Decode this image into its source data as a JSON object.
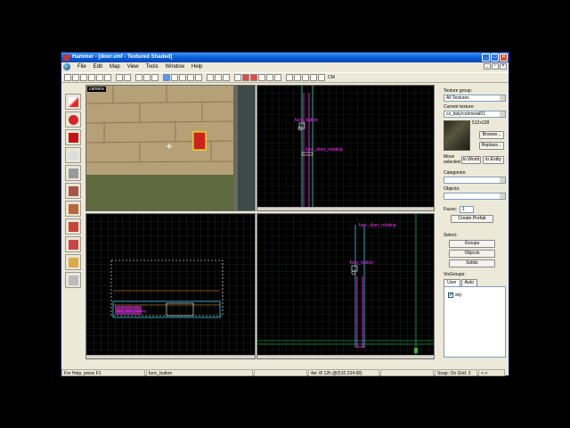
{
  "window": {
    "title": "Hammer - [door.vmf - Textured Shaded]"
  },
  "menu": [
    "File",
    "Edit",
    "Map",
    "View",
    "Tools",
    "Window",
    "Help"
  ],
  "toolbar": {
    "cm_label": "CM"
  },
  "viewports": {
    "camera_label": "camera",
    "top_labels": [
      "func_button",
      "func_door_rotating"
    ],
    "side_labels": [
      "func_door_rotating",
      "func_button",
      "door"
    ],
    "front_labels": [
      "func_door_rotating"
    ]
  },
  "texture_panel": {
    "group_label": "Texture group:",
    "group_value": "All Textures",
    "current_label": "Current texture:",
    "current_value": "cs_italy/cobmetal01",
    "size": "512x128",
    "browse": "Browse...",
    "replace": "Replace...",
    "move_label": "Move selected",
    "to_world": "to World",
    "to_entity": "to Entity",
    "categories_label": "Categories:",
    "objects_label": "Objects:",
    "faces_label": "Faces:",
    "faces_value": "1",
    "create_prefab": "Create Prefab",
    "select_label": "Select:",
    "groups": "Groups",
    "objects_btn": "Objects",
    "solids": "Solids",
    "visgroups_label": "VisGroups:",
    "tab_user": "User",
    "tab_auto": "Auto",
    "visgroup_item": "sky",
    "visgroup_checked": "✔"
  },
  "status": {
    "help": "For Help, press F1",
    "selection": "func_button",
    "coords": "4w: 8l 12h @(510 234 68)",
    "snap": "Snap: On Grid: 2",
    "extra": "<->"
  },
  "colors": {
    "grid": "#2f3a2f",
    "selection": "#ff33ff",
    "entity": "#ffffff"
  }
}
